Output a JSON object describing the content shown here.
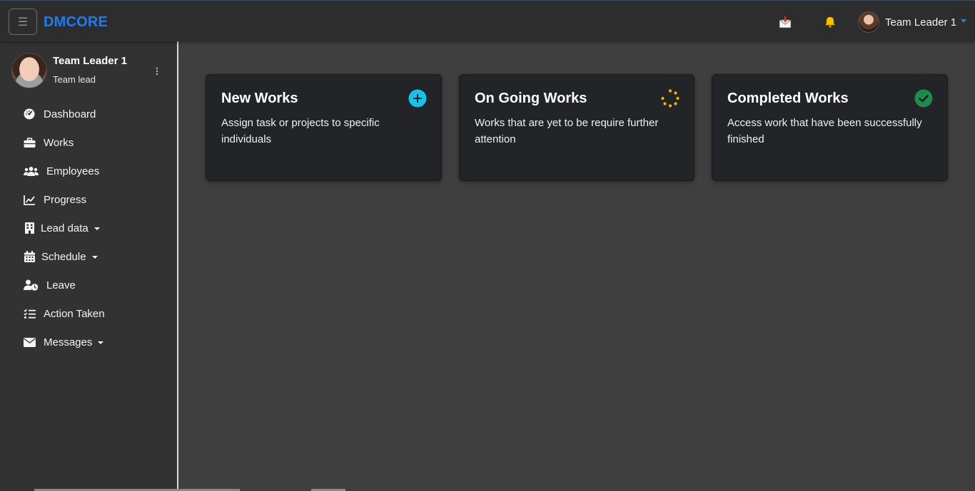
{
  "topbar": {
    "menu_glyph": "☰",
    "brand": "DMCORE",
    "mail_icon": "mail-inbox-icon",
    "bell_icon": "bell-icon",
    "user_name": "Team Leader 1"
  },
  "sidebar": {
    "profile": {
      "name": "Team Leader 1",
      "role": "Team lead"
    },
    "items": [
      {
        "label": "Dashboard",
        "icon": "dashboard-gauge-icon"
      },
      {
        "label": "Works",
        "icon": "briefcase-icon"
      },
      {
        "label": "Employees",
        "icon": "users-icon"
      },
      {
        "label": "Progress",
        "icon": "line-chart-icon"
      },
      {
        "label": "Lead data",
        "icon": "building-icon"
      },
      {
        "label": "Schedule",
        "icon": "calendar-icon"
      },
      {
        "label": "Leave",
        "icon": "user-clock-icon"
      },
      {
        "label": "Action Taken",
        "icon": "list-check-icon"
      },
      {
        "label": "Messages",
        "icon": "envelope-icon"
      }
    ]
  },
  "cards": [
    {
      "title": "New Works",
      "description": "Assign task or projects to specific individuals",
      "icon": "plus-circle-icon",
      "accent": "#17c2e6"
    },
    {
      "title": "On Going Works",
      "description": "Works that are yet to be require further attention",
      "icon": "spinner-icon",
      "accent": "#f5b400"
    },
    {
      "title": "Completed Works",
      "description": "Access work that have been successfully finished",
      "icon": "check-circle-icon",
      "accent": "#1f8a4c"
    }
  ],
  "colors": {
    "brand": "#1e7bf0",
    "background": "#3f3f3f",
    "sidebar": "#323233",
    "card": "#232427"
  }
}
